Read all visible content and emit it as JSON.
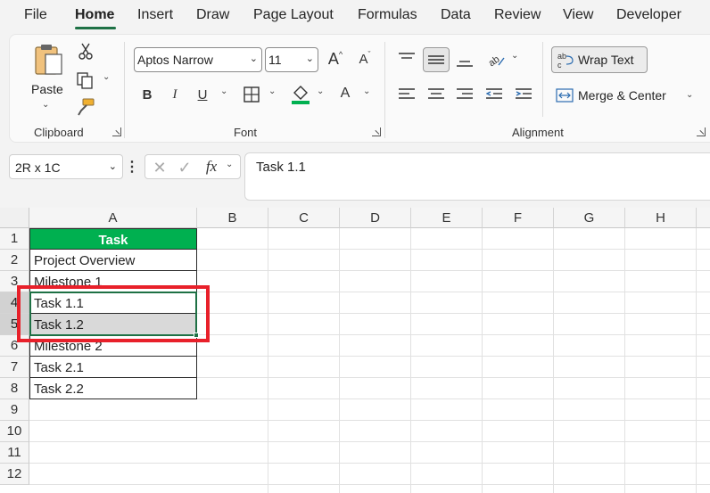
{
  "menu": {
    "tabs": [
      "File",
      "Home",
      "Insert",
      "Draw",
      "Page Layout",
      "Formulas",
      "Data",
      "Review",
      "View",
      "Developer"
    ],
    "active": "Home"
  },
  "ribbon": {
    "clipboard": {
      "paste_label": "Paste",
      "group_label": "Clipboard"
    },
    "font": {
      "font_name": "Aptos Narrow",
      "font_size": "11",
      "group_label": "Font",
      "fill_color": "#00b050"
    },
    "alignment": {
      "wrap_text": "Wrap Text",
      "merge_center": "Merge & Center",
      "group_label": "Alignment"
    }
  },
  "formula_bar": {
    "name_box": "2R x 1C",
    "fx": "fx",
    "value": "Task 1.1"
  },
  "sheet": {
    "columns": [
      "A",
      "B",
      "C",
      "D",
      "E",
      "F",
      "G",
      "H"
    ],
    "rows": [
      "1",
      "2",
      "3",
      "4",
      "5",
      "6",
      "7",
      "8",
      "9",
      "10",
      "11",
      "12"
    ],
    "cells": [
      "Task",
      "Project Overview",
      "Milestone 1",
      "Task 1.1",
      "Task 1.2",
      "Milestone 2",
      "Task 2.1",
      "Task 2.2"
    ],
    "header_color": "#00b050",
    "selection_color": "#1e7145",
    "highlight_color": "#e8202a"
  }
}
